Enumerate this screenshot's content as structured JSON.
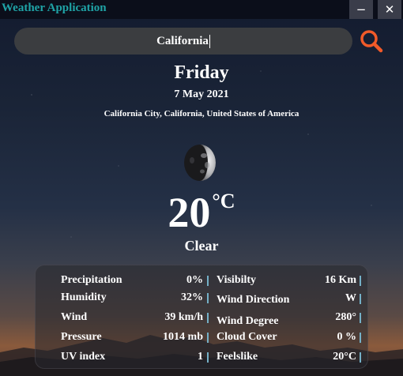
{
  "window": {
    "title": "Weather Application",
    "minimize_label": "−",
    "close_label": "✕"
  },
  "search": {
    "value": "California",
    "icon": "magnifier-icon",
    "icon_color": "#f15a29"
  },
  "weather": {
    "day": "Friday",
    "date": "7 May 2021",
    "location": "California City, California, United States of America",
    "icon": "moon-icon",
    "temperature": "20",
    "unit": "°C",
    "condition": "Clear"
  },
  "details": {
    "left": [
      {
        "label": "Precipitation",
        "value": "0%"
      },
      {
        "label": "Humidity",
        "value": "32%"
      },
      {
        "label": "Wind",
        "value": "39 km/h"
      },
      {
        "label": "Pressure",
        "value": "1014 mb"
      },
      {
        "label": "UV index",
        "value": "1"
      }
    ],
    "right": [
      {
        "label": "Visibilty",
        "value": "16 Km"
      },
      {
        "label": "Wind Direction",
        "value": "W"
      },
      {
        "label": "Wind Degree",
        "value": "280°"
      },
      {
        "label": "Cloud Cover",
        "value": "0 %"
      },
      {
        "label": "Feelslike",
        "value": "20°C"
      }
    ]
  },
  "colors": {
    "title_text": "#1fa3a6",
    "separator": "#74b0c7",
    "search_bg": "#3b3d40"
  }
}
